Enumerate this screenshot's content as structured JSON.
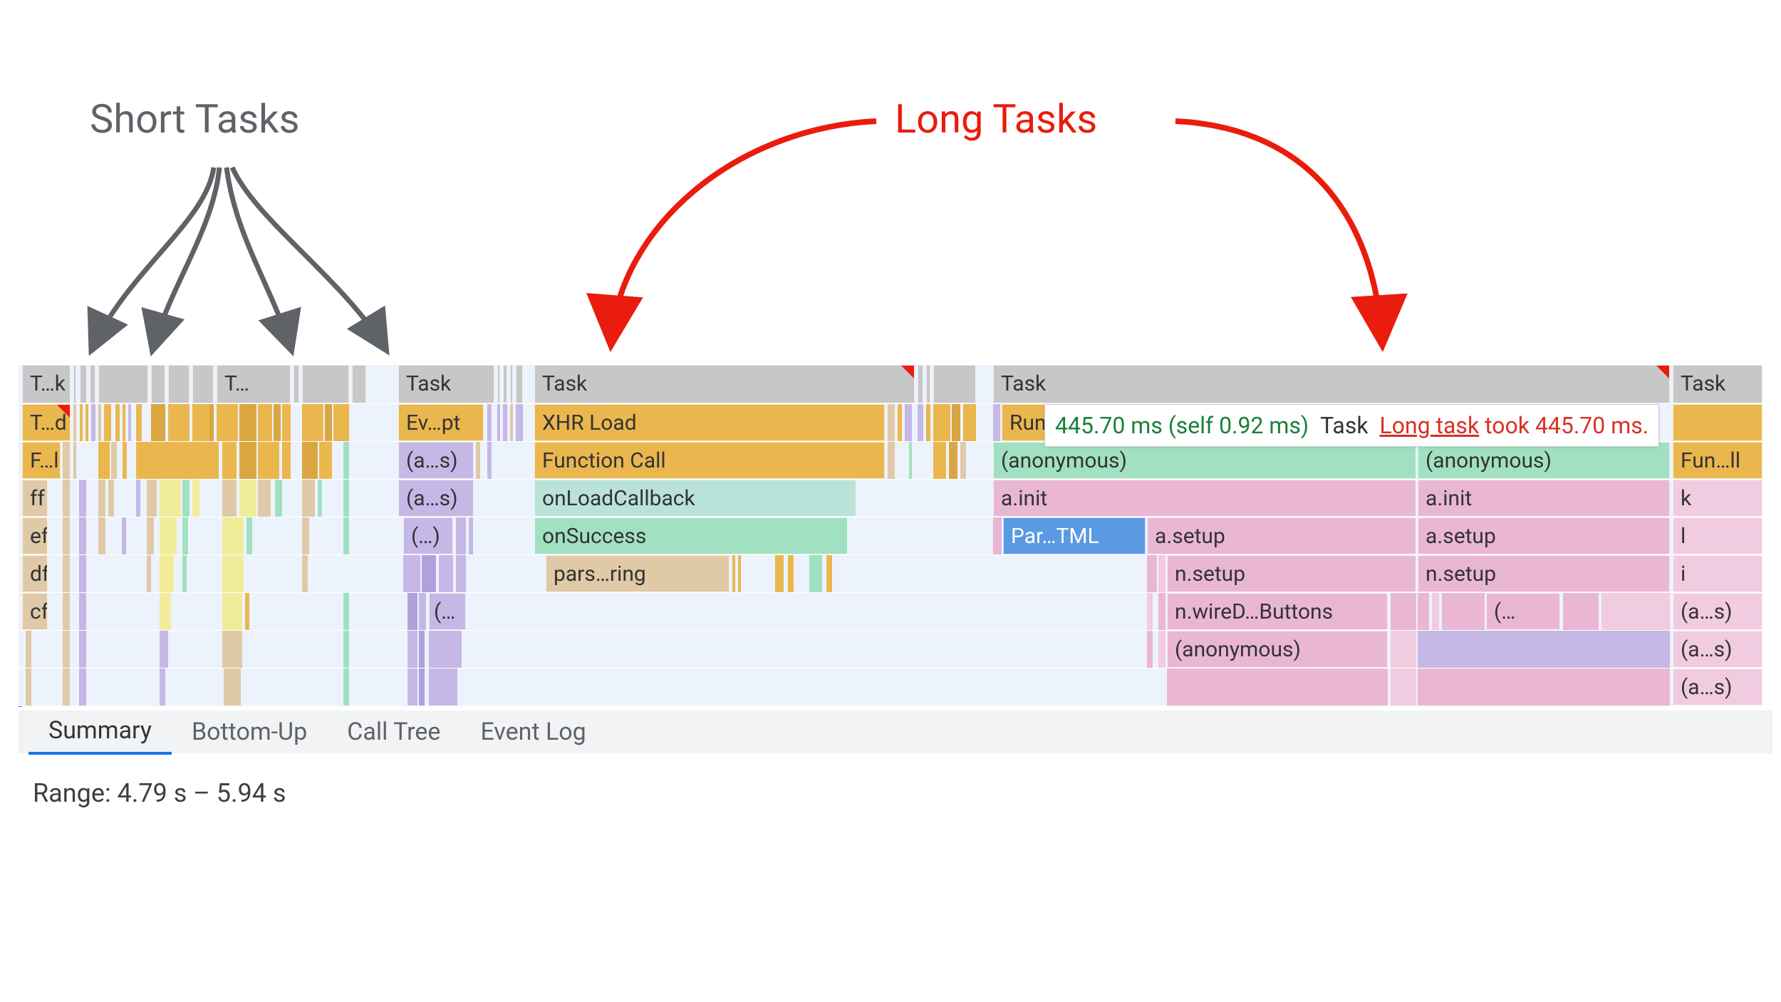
{
  "annotations": {
    "short_tasks_label": "Short Tasks",
    "long_tasks_label": "Long Tasks"
  },
  "tooltip": {
    "time": "445.70 ms (self 0.92 ms)",
    "task_word": "Task",
    "link": "Long task",
    "took": "took 445.70 ms."
  },
  "flame": {
    "col0_labels": [
      "T…k",
      "T…d",
      "F…l",
      "ff",
      "ef",
      "df",
      "cf"
    ],
    "col0_extra": "T…",
    "col1": {
      "task": "Task",
      "ev": "Ev…pt",
      "as1": "(a…s)",
      "as2": "(a…s)",
      "paren": "(…)",
      "paren2": "(…"
    },
    "col2": {
      "task": "Task",
      "xhr": "XHR Load",
      "fn": "Function Call",
      "onload": "onLoadCallback",
      "onsuccess": "onSuccess",
      "parsing": "pars…ring"
    },
    "col3": {
      "task": "Task",
      "run": "Run",
      "anon1": "(anonymous)",
      "anon2": "(anonymous)",
      "ainit1": "a.init",
      "ainit2": "a.init",
      "partml": "Par…TML",
      "asetup1": "a.setup",
      "asetup2": "a.setup",
      "nsetup1": "n.setup",
      "nsetup2": "n.setup",
      "nwire": "n.wireD…Buttons",
      "paren": "(…",
      "anon3": "(anonymous)"
    },
    "col4": {
      "task": "Task",
      "fun": "Fun…ll",
      "k": "k",
      "l": "l",
      "i": "i",
      "as1": "(a…s)",
      "as2": "(a…s)",
      "as3": "(a…s)"
    }
  },
  "tabs": [
    "Summary",
    "Bottom-Up",
    "Call Tree",
    "Event Log"
  ],
  "range": "Range: 4.79 s – 5.94 s"
}
